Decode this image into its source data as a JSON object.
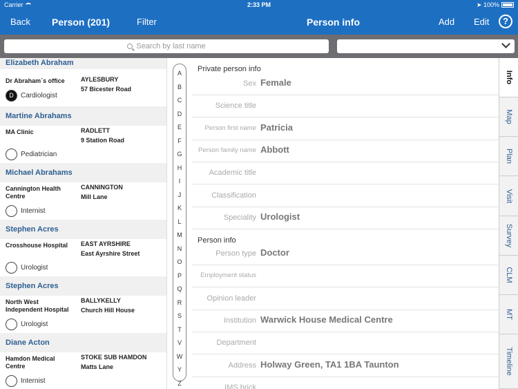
{
  "status_bar": {
    "carrier": "Carrier",
    "time": "2:33 PM",
    "battery": "100%"
  },
  "nav": {
    "back": "Back",
    "list_title": "Person (201)",
    "filter": "Filter",
    "detail_title": "Person info",
    "add": "Add",
    "edit": "Edit",
    "help": "?"
  },
  "search": {
    "placeholder": "Search by last name"
  },
  "persons": [
    {
      "name": "Elizabeth  Abraham",
      "org": "Dr Abraham´s office",
      "city": "AYLESBURY",
      "street": "57 Bicester Road",
      "initial": "D",
      "specialty": "Cardiologist"
    },
    {
      "name": "Martine  Abrahams",
      "org": "MA Clinic",
      "city": "RADLETT",
      "street": "9 Station Road",
      "initial": "",
      "specialty": "Pediatrician"
    },
    {
      "name": "Michael  Abrahams",
      "org": "Cannington Health Centre",
      "city": "CANNINGTON",
      "street": "Mill Lane",
      "initial": "",
      "specialty": "Internist"
    },
    {
      "name": "Stephen  Acres",
      "org": "Crosshouse Hospital",
      "city": "EAST AYRSHIRE",
      "street": "East Ayrshire Street",
      "initial": "",
      "specialty": "Urologist"
    },
    {
      "name": "Stephen  Acres",
      "org": "North West Independent Hospital",
      "city": "BALLYKELLY",
      "street": "Church Hill House",
      "initial": "",
      "specialty": "Urologist"
    },
    {
      "name": "Diane  Acton",
      "org": "Hamdon Medical Centre",
      "city": "STOKE SUB HAMDON",
      "street": "Matts Lane",
      "initial": "",
      "specialty": "Internist"
    }
  ],
  "alphabet": [
    "A",
    "B",
    "C",
    "D",
    "E",
    "F",
    "G",
    "H",
    "I",
    "J",
    "K",
    "L",
    "M",
    "N",
    "O",
    "P",
    "Q",
    "R",
    "S",
    "T",
    "V",
    "W",
    "Y",
    "Z"
  ],
  "detail": {
    "private_section": "Private person info",
    "person_section": "Person info",
    "private_rows": [
      {
        "label": "Sex",
        "value": "Female"
      },
      {
        "label": "Science title",
        "value": ""
      },
      {
        "label": "Person first name",
        "value": "Patricia"
      },
      {
        "label": "Person family name",
        "value": "Abbott"
      },
      {
        "label": "Academic title",
        "value": ""
      },
      {
        "label": "Classification",
        "value": ""
      },
      {
        "label": "Speciality",
        "value": "Urologist"
      }
    ],
    "person_rows": [
      {
        "label": "Person type",
        "value": "Doctor"
      },
      {
        "label": "Employment status",
        "value": ""
      },
      {
        "label": "Opinion leader",
        "value": ""
      },
      {
        "label": "Institution",
        "value": "Warwick House Medical Centre"
      },
      {
        "label": "Department",
        "value": ""
      },
      {
        "label": "Address",
        "value": "Holway Green, TA1 1BA Taunton"
      },
      {
        "label": "IMS brick",
        "value": ""
      }
    ]
  },
  "tabs": [
    "Info",
    "Map",
    "Plan",
    "Visit",
    "Survey",
    "CLM",
    "MT",
    "Timeline"
  ],
  "colors": {
    "bar": "#1d6fc2",
    "search_bg": "#6d6d72",
    "name": "#2e5f93"
  }
}
